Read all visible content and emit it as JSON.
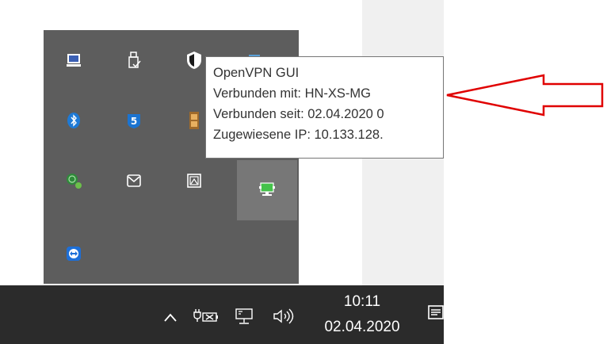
{
  "tooltip": {
    "lines": [
      "OpenVPN GUI",
      "Verbunden mit: HN-XS-MG",
      "Verbunden seit: 02.04.2020 0",
      "Zugewiesene IP: 10.133.128."
    ]
  },
  "taskbar": {
    "time": "10:11",
    "date": "02.04.2020"
  },
  "tray_icons": [
    "laptop-icon",
    "usb-drive-icon",
    "security-shield-icon",
    "blue-app-icon",
    "bluetooth-icon",
    "shield-5-icon",
    "film-app-icon",
    "network-globe-icon",
    "mail-icon",
    "image-frame-icon",
    "openvpn-connected-icon",
    "teamviewer-icon"
  ],
  "colors": {
    "flyout_bg": "#5d5d5d",
    "taskbar_bg": "#2b2b2b",
    "callout_red": "#e00000",
    "vpn_green": "#44c24a"
  }
}
